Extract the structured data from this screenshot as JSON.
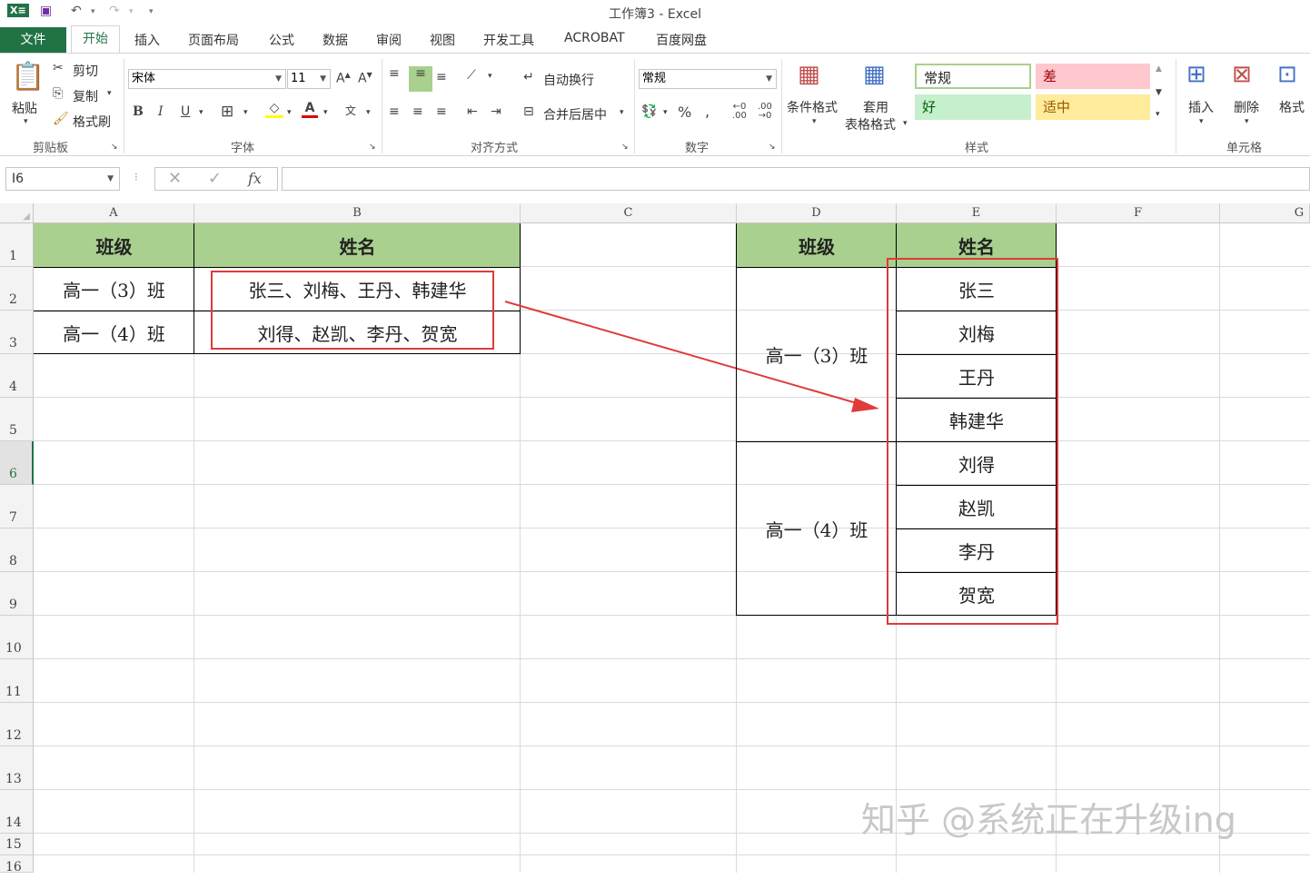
{
  "window": {
    "title": "工作簿3 - Excel",
    "app_badge": "X≡"
  },
  "tabs": [
    {
      "label": "文件"
    },
    {
      "label": "开始"
    },
    {
      "label": "插入"
    },
    {
      "label": "页面布局"
    },
    {
      "label": "公式"
    },
    {
      "label": "数据"
    },
    {
      "label": "审阅"
    },
    {
      "label": "视图"
    },
    {
      "label": "开发工具"
    },
    {
      "label": "ACROBAT"
    },
    {
      "label": "百度网盘"
    }
  ],
  "ribbon": {
    "clipboard": {
      "paste": "粘贴",
      "cut": "剪切",
      "copy": "复制",
      "format_painter": "格式刷",
      "group": "剪贴板"
    },
    "font": {
      "name": "宋体",
      "size": "11",
      "bold": "B",
      "italic": "I",
      "underline": "U",
      "group": "字体"
    },
    "alignment": {
      "wrap": "自动换行",
      "merge": "合并后居中",
      "group": "对齐方式"
    },
    "number": {
      "format": "常规",
      "group": "数字"
    },
    "styles": {
      "conditional": "条件格式",
      "table_format_1": "套用",
      "table_format_2": "表格格式",
      "normal": "常规",
      "bad": "差",
      "good": "好",
      "neutral": "适中",
      "group": "样式"
    },
    "cells": {
      "insert": "插入",
      "delete": "删除",
      "format": "格式",
      "group": "单元格"
    }
  },
  "formula_bar": {
    "name_box": "I6",
    "fx": "fx",
    "value": ""
  },
  "columns": [
    "A",
    "B",
    "C",
    "D",
    "E",
    "F",
    "G"
  ],
  "rows": [
    "1",
    "2",
    "3",
    "4",
    "5",
    "6",
    "7",
    "8",
    "9",
    "10",
    "11",
    "12",
    "13",
    "14",
    "15",
    "16"
  ],
  "source_table": {
    "headers": [
      "班级",
      "姓名"
    ],
    "rows": [
      {
        "class": "高一（3）班",
        "names": "张三、刘梅、王丹、韩建华"
      },
      {
        "class": "高一（4）班",
        "names": "刘得、赵凯、李丹、贺宽"
      }
    ]
  },
  "result_table": {
    "headers": [
      "班级",
      "姓名"
    ],
    "groups": [
      {
        "class": "高一（3）班",
        "names": [
          "张三",
          "刘梅",
          "王丹",
          "韩建华"
        ]
      },
      {
        "class": "高一（4）班",
        "names": [
          "刘得",
          "赵凯",
          "李丹",
          "贺宽"
        ]
      }
    ]
  },
  "watermark": "知乎 @系统正在升级ing",
  "colors": {
    "excel_green": "#217346",
    "header_fill": "#a9d08e",
    "highlight_red": "#e03a3a"
  }
}
